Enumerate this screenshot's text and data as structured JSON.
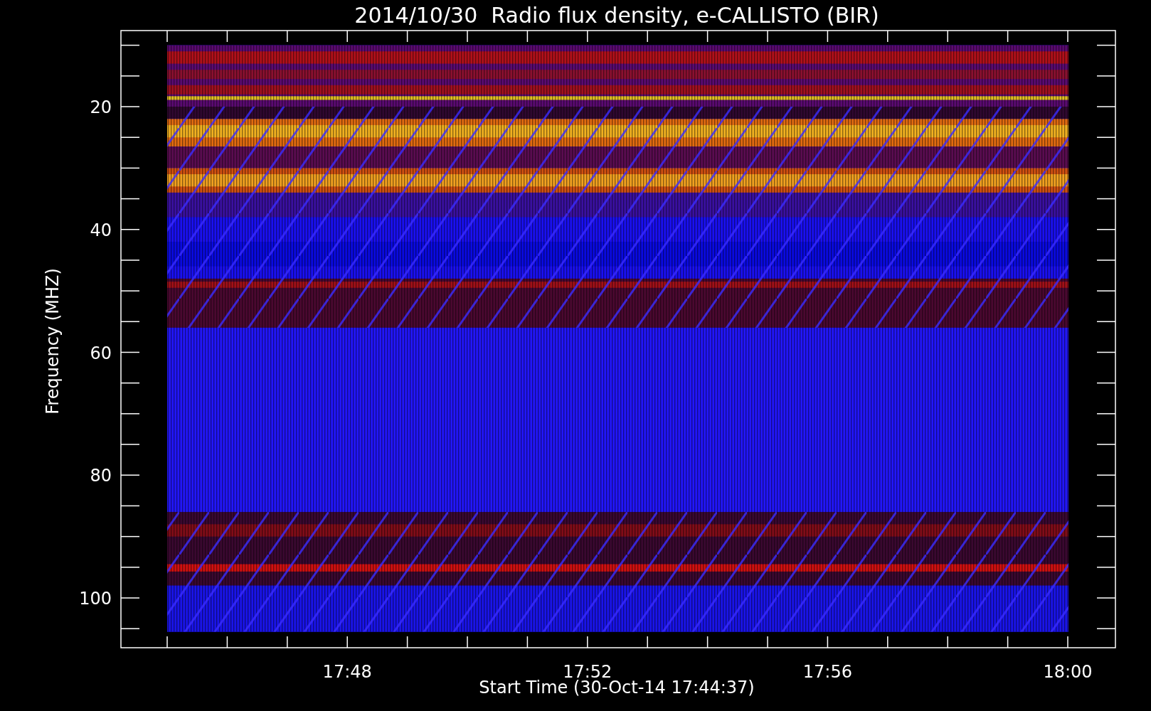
{
  "title": "2014/10/30  Radio flux density, e-CALLISTO (BIR)",
  "ylabel": "Frequency (MHZ)",
  "xlabel": "Start Time (30-Oct-14 17:44:37)",
  "y_tick_labels": [
    "20",
    "40",
    "60",
    "80",
    "100"
  ],
  "x_tick_labels": [
    "17:48",
    "17:52",
    "17:56",
    "18:00"
  ]
}
